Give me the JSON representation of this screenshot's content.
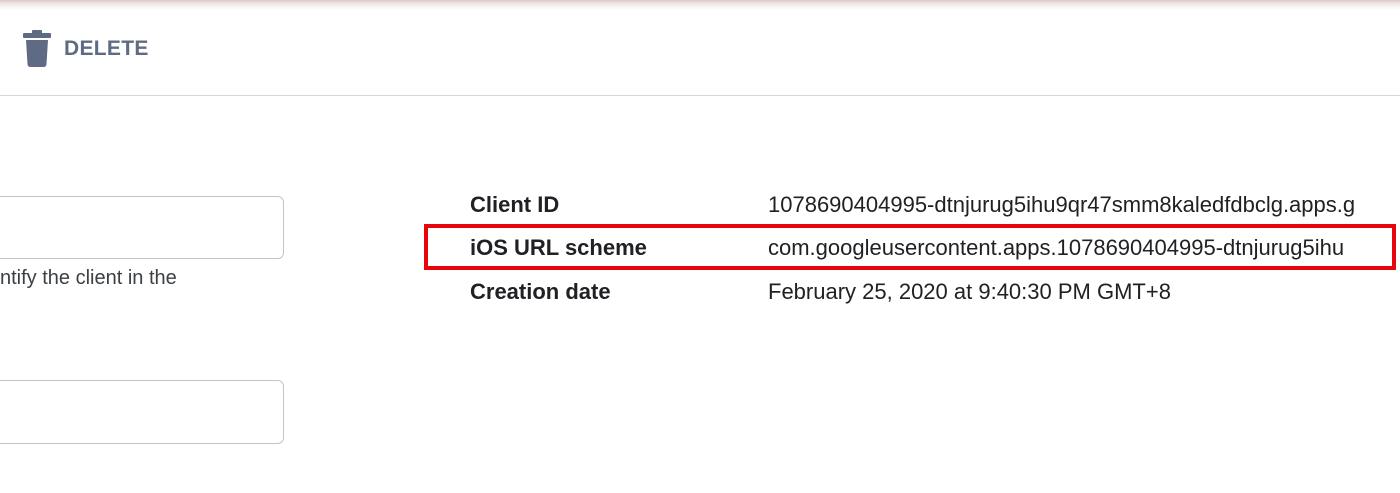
{
  "toolbar": {
    "delete_label": "DELETE",
    "delete_icon": "trash-icon"
  },
  "form": {
    "helper_text": "ntify the client in the"
  },
  "details": {
    "client_id_label": "Client ID",
    "client_id_value": "1078690404995-dtnjurug5ihu9qr47smm8kaledfdbclg.apps.g",
    "ios_scheme_label": "iOS URL scheme",
    "ios_scheme_value": "com.googleusercontent.apps.1078690404995-dtnjurug5ihu",
    "creation_date_label": "Creation date",
    "creation_date_value": "February 25, 2020 at 9:40:30 PM GMT+8"
  },
  "colors": {
    "highlight_border": "#e8060c",
    "toolbar_text": "#5f6b85"
  }
}
